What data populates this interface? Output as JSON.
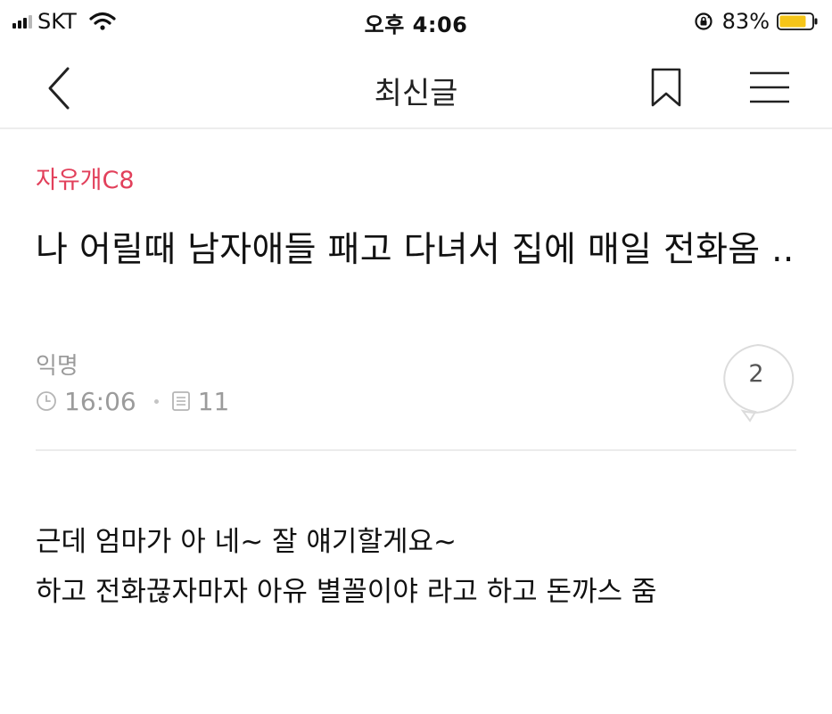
{
  "status_bar": {
    "carrier": "SKT",
    "time": "오후 4:06",
    "battery_percent": "83%",
    "battery_level": 0.83,
    "signal_bars_active": 3,
    "signal_bars_total": 4
  },
  "nav": {
    "title": "최신글",
    "back_icon": "chevron-left-icon",
    "bookmark_icon": "bookmark-icon",
    "menu_icon": "hamburger-menu-icon"
  },
  "post": {
    "board": "자유개C8",
    "title": "나 어릴때 남자애들 패고 다녀서 집에 매일 전화옴 ..",
    "author": "익명",
    "time": "16:06",
    "views": "11",
    "comment_count": "2",
    "body_lines": [
      "근데 엄마가 아 네~ 잘 얘기할게요~",
      "하고 전화끊자마자 아유 별꼴이야 라고 하고 돈까스 줌"
    ]
  },
  "colors": {
    "board_accent": "#e2405b",
    "battery_fill": "#f5c518",
    "meta_gray": "#9b9b9b"
  }
}
